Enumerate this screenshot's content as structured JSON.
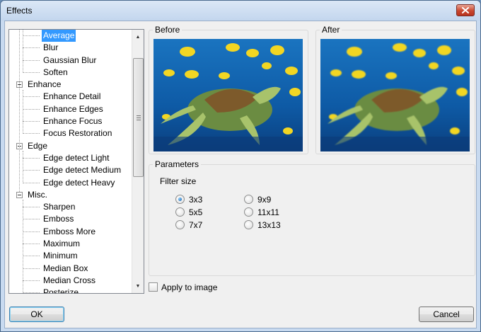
{
  "window": {
    "title": "Effects",
    "close_icon": "close-icon"
  },
  "tree": {
    "rows": [
      {
        "type": "child",
        "label": "Average",
        "selected": true
      },
      {
        "type": "child",
        "label": "Blur"
      },
      {
        "type": "child",
        "label": "Gaussian Blur"
      },
      {
        "type": "child",
        "label": "Soften"
      },
      {
        "type": "parent",
        "label": "Enhance"
      },
      {
        "type": "child",
        "label": "Enhance Detail"
      },
      {
        "type": "child",
        "label": "Enhance Edges"
      },
      {
        "type": "child",
        "label": "Enhance Focus"
      },
      {
        "type": "child",
        "label": "Focus Restoration"
      },
      {
        "type": "parent",
        "label": "Edge"
      },
      {
        "type": "child",
        "label": "Edge detect Light"
      },
      {
        "type": "child",
        "label": "Edge detect Medium"
      },
      {
        "type": "child",
        "label": "Edge detect Heavy"
      },
      {
        "type": "parent",
        "label": "Misc."
      },
      {
        "type": "child",
        "label": "Sharpen"
      },
      {
        "type": "child",
        "label": "Emboss"
      },
      {
        "type": "child",
        "label": "Emboss More"
      },
      {
        "type": "child",
        "label": "Maximum"
      },
      {
        "type": "child",
        "label": "Minimum"
      },
      {
        "type": "child",
        "label": "Median Box"
      },
      {
        "type": "child",
        "label": "Median Cross"
      },
      {
        "type": "child",
        "label": "Posterize"
      }
    ]
  },
  "before": {
    "title": "Before"
  },
  "after": {
    "title": "After"
  },
  "parameters": {
    "title": "Parameters",
    "filter_size_label": "Filter size",
    "options": [
      {
        "label": "3x3",
        "checked": true
      },
      {
        "label": "5x5",
        "checked": false
      },
      {
        "label": "7x7",
        "checked": false
      },
      {
        "label": "9x9",
        "checked": false
      },
      {
        "label": "11x11",
        "checked": false
      },
      {
        "label": "13x13",
        "checked": false
      }
    ]
  },
  "apply_to_image": {
    "label": "Apply to image",
    "checked": false
  },
  "buttons": {
    "ok": "OK",
    "cancel": "Cancel"
  },
  "colors": {
    "selection": "#3399ff",
    "water": "#1d6fb8",
    "fish": "#f2d623"
  }
}
